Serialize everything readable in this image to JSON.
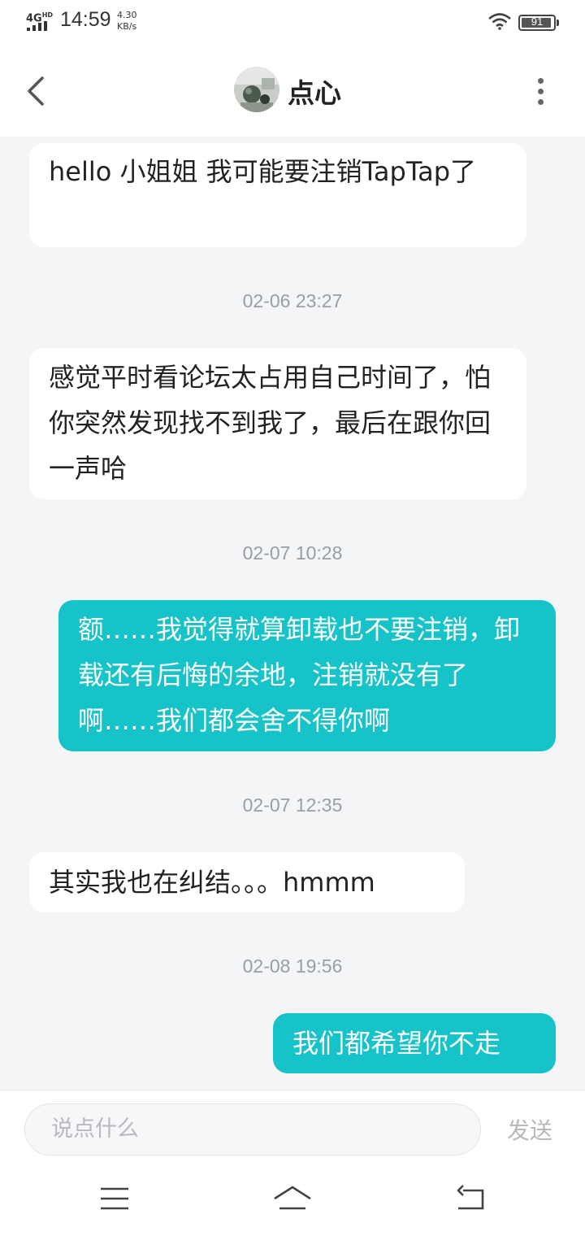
{
  "status_bar": {
    "network": "4G",
    "network_sup": "HD",
    "time": "14:59",
    "speed_value": "4.30",
    "speed_unit": "KB/s",
    "battery": "91"
  },
  "header": {
    "title": "点心"
  },
  "messages": [
    {
      "type": "in",
      "text": "hello 小姐姐 我可能要注销TapTap了"
    },
    {
      "type": "timestamp",
      "text": "02-06 23:27"
    },
    {
      "type": "in",
      "text": "感觉平时看论坛太占用自己时间了，怕你突然发现找不到我了，最后在跟你回一声哈"
    },
    {
      "type": "timestamp",
      "text": "02-07 10:28"
    },
    {
      "type": "out",
      "text": "额……我觉得就算卸载也不要注销，卸载还有后悔的余地，注销就没有了啊……我们都会舍不得你啊"
    },
    {
      "type": "timestamp",
      "text": "02-07 12:35"
    },
    {
      "type": "in",
      "text": "其实我也在纠结。。。hmmm"
    },
    {
      "type": "timestamp",
      "text": "02-08 19:56"
    },
    {
      "type": "out",
      "text": "我们都希望你不走"
    }
  ],
  "input": {
    "placeholder": "说点什么",
    "send_label": "发送"
  },
  "icons": {
    "back": "chevron-left-icon",
    "more": "more-vertical-icon",
    "menu": "menu-icon",
    "home": "home-icon",
    "return": "return-icon"
  },
  "colors": {
    "outgoing_bubble": "#15c3c9",
    "incoming_bubble": "#ffffff",
    "background": "#f4f5f7"
  }
}
